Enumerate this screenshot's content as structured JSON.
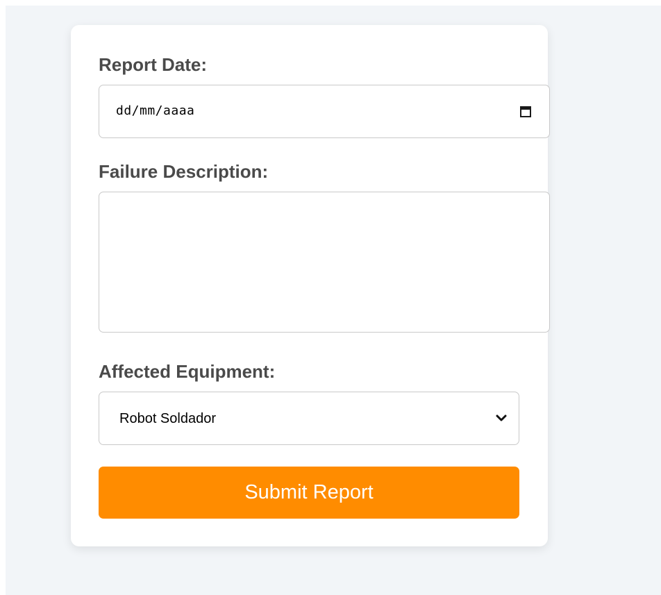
{
  "form": {
    "report_date": {
      "label": "Report Date:",
      "value_placeholder": "dd/mm/aaaa",
      "icon": "calendar-icon"
    },
    "failure_description": {
      "label": "Failure Description:",
      "value": ""
    },
    "affected_equipment": {
      "label": "Affected Equipment:",
      "selected": "Robot Soldador",
      "icon": "chevron-down-icon"
    },
    "submit_label": "Submit Report"
  },
  "colors": {
    "background": "#f2f5f8",
    "card": "#ffffff",
    "label": "#4a4a4a",
    "border": "#c9c9c9",
    "accent": "#ff8c00"
  }
}
